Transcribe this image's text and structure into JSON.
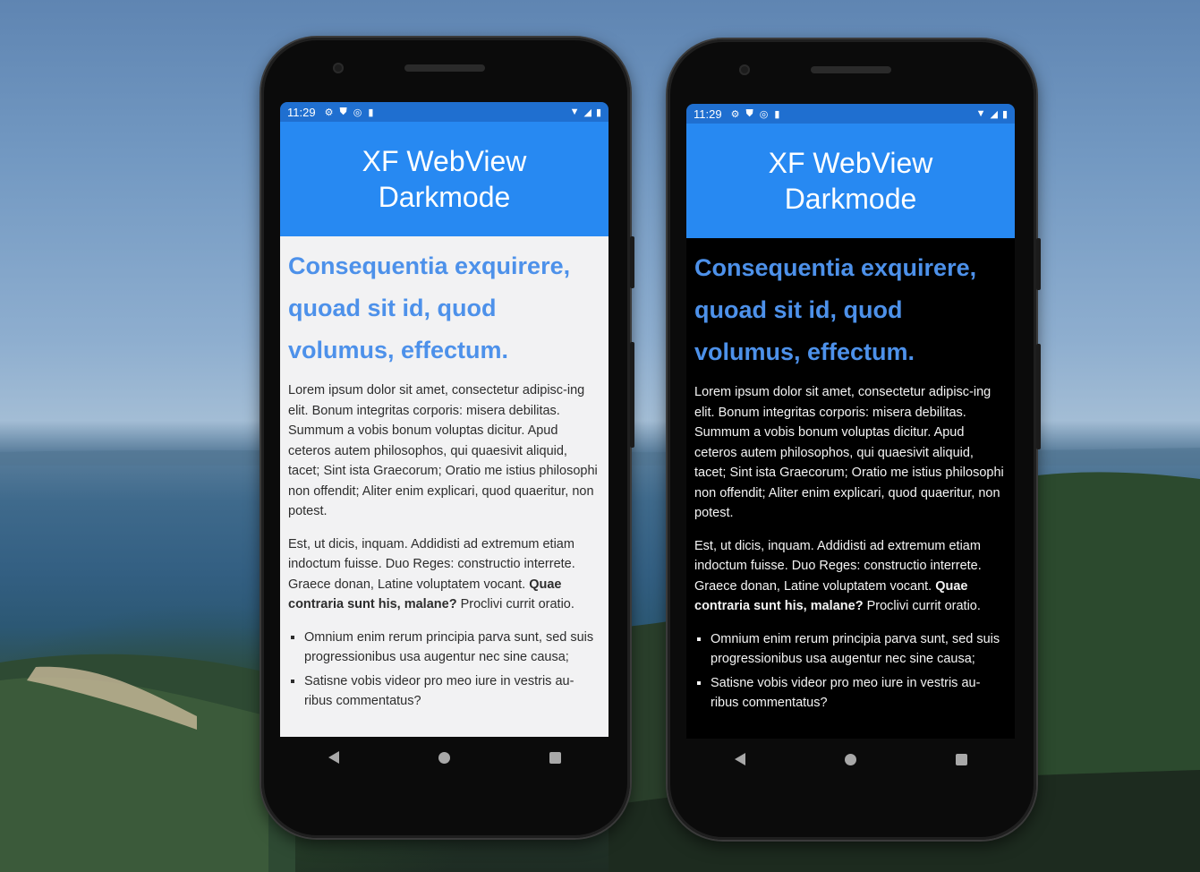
{
  "devices": [
    {
      "theme": "light",
      "status": {
        "time": "11:29"
      },
      "app_title": "XF WebView Darkmode",
      "heading": "Consequentia exquirere, quoad sit id, quod volumus, effectum.",
      "para1": "Lorem ipsum dolor sit amet, consectetur adipisc-ing elit. Bonum integritas corporis: misera debilitas. Summum a vobis bonum voluptas dicitur. Apud ceteros autem philosophos, qui quaesivit aliquid, tacet; Sint ista Graecorum; Oratio me istius philosophi non offendit; Aliter enim explicari, quod quaeritur, non potest.",
      "para2_start": "Est, ut dicis, inquam. Addidisti ad extremum etiam indoctum fuisse. Duo Reges: constructio interrete. Graece donan, Latine voluptatem vocant. ",
      "para2_bold": "Quae contraria sunt his, malane?",
      "para2_end": " Proclivi currit oratio.",
      "list": [
        "Omnium enim rerum principia parva sunt, sed suis progressionibus usa augentur nec sine causa;",
        "Satisne vobis videor pro meo iure in vestris au-ribus commentatus?"
      ]
    },
    {
      "theme": "dark",
      "status": {
        "time": "11:29"
      },
      "app_title": "XF WebView Darkmode",
      "heading": "Consequentia exquirere, quoad sit id, quod volumus, effectum.",
      "para1": "Lorem ipsum dolor sit amet, consectetur adipisc-ing elit. Bonum integritas corporis: misera debilitas. Summum a vobis bonum voluptas dicitur. Apud ceteros autem philosophos, qui quaesivit aliquid, tacet; Sint ista Graecorum; Oratio me istius philosophi non offendit; Aliter enim explicari, quod quaeritur, non potest.",
      "para2_start": "Est, ut dicis, inquam. Addidisti ad extremum etiam indoctum fuisse. Duo Reges: constructio interrete. Graece donan, Latine voluptatem vocant. ",
      "para2_bold": "Quae contraria sunt his, malane?",
      "para2_end": " Proclivi currit oratio.",
      "list": [
        "Omnium enim rerum principia parva sunt, sed suis progressionibus usa augentur nec sine causa;",
        "Satisne vobis videor pro meo iure in vestris au-ribus commentatus?"
      ]
    }
  ],
  "colors": {
    "status_bar": "#1f6fd0",
    "app_bar": "#2789f2",
    "heading": "#4d91ea",
    "light_bg": "#f2f2f3",
    "dark_bg": "#000000"
  },
  "icons": [
    "settings-icon",
    "shield-icon",
    "sync-icon",
    "sd-card-icon",
    "wifi-icon",
    "signal-icon",
    "battery-icon",
    "nav-back-icon",
    "nav-home-icon",
    "nav-recents-icon"
  ]
}
